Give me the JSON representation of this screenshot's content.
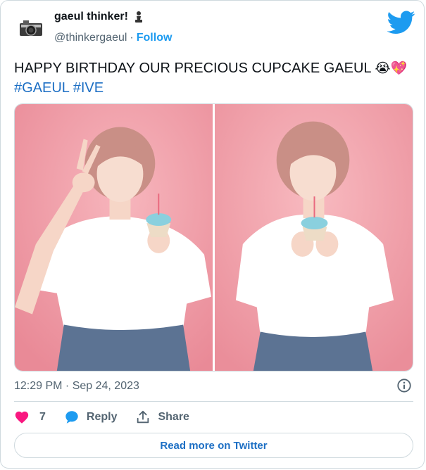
{
  "colors": {
    "accent": "#1d9bf0",
    "hashtag": "#1d6fc4",
    "heart": "#f91880",
    "muted": "#536471",
    "photo_background": "#f3a3ad"
  },
  "author": {
    "display_name": "gaeul thinker!",
    "name_emoji_icon": "chess-pawn-icon",
    "handle": "@thinkergaeul",
    "separator": "·",
    "follow_label": "Follow",
    "avatar_icon": "camera-icon"
  },
  "tweet": {
    "text": "HAPPY BIRTHDAY OUR PRECIOUS CUPCAKE GAEUL",
    "emoji_1": "😭",
    "emoji_2": "💖",
    "hashtags": [
      "#GAEUL",
      "#IVE"
    ]
  },
  "media": {
    "photos": [
      {
        "icon": "photo-peace-sign-cupcake"
      },
      {
        "icon": "photo-holding-cupcake"
      }
    ]
  },
  "meta": {
    "timestamp": "12:29 PM · Sep 24, 2023"
  },
  "actions": {
    "like_count": "7",
    "reply_label": "Reply",
    "share_label": "Share"
  },
  "footer": {
    "read_more_label": "Read more on Twitter"
  }
}
